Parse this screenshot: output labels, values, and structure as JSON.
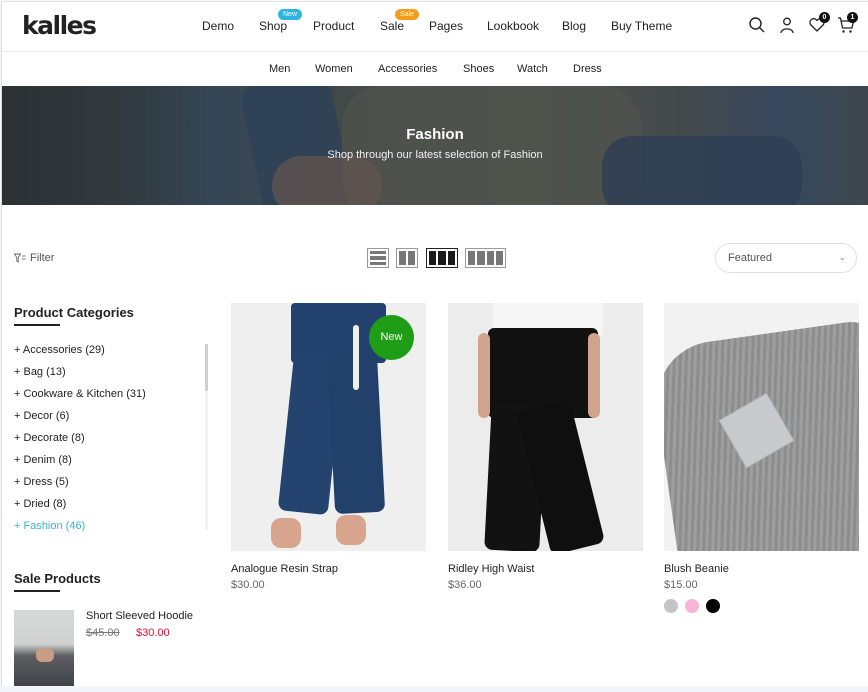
{
  "header": {
    "logo": "kalles",
    "nav": [
      {
        "label": "Demo"
      },
      {
        "label": "Shop",
        "badge": "New"
      },
      {
        "label": "Product"
      },
      {
        "label": "Sale",
        "badge": "Sale"
      },
      {
        "label": "Pages"
      },
      {
        "label": "Lookbook"
      },
      {
        "label": "Blog"
      },
      {
        "label": "Buy Theme"
      }
    ],
    "icons": {
      "search": "search-icon",
      "account": "user-icon",
      "wishlist": "heart-icon",
      "cart": "cart-icon"
    },
    "wishlist_count": "0",
    "cart_count": "1"
  },
  "subnav": [
    "Men",
    "Women",
    "Accessories",
    "Shoes",
    "Watch",
    "Dress"
  ],
  "hero": {
    "title": "Fashion",
    "subtitle": "Shop through our latest selection of Fashion"
  },
  "toolbar": {
    "filter_label": "Filter",
    "layouts": [
      "list",
      "2-columns",
      "3-columns",
      "4-columns"
    ],
    "active_layout": "3-columns",
    "sort_value": "Featured"
  },
  "sidebar": {
    "categories_title": "Product Categories",
    "categories": [
      {
        "label": "+ Accessories (29)"
      },
      {
        "label": "+ Bag (13)"
      },
      {
        "label": "+ Cookware & Kitchen (31)"
      },
      {
        "label": "+ Decor (6)"
      },
      {
        "label": "+ Decorate (8)"
      },
      {
        "label": "+ Denim (8)"
      },
      {
        "label": "+ Dress (5)"
      },
      {
        "label": "+ Dried (8)"
      },
      {
        "label": "+ Fashion (46)",
        "active": true
      }
    ],
    "sale_title": "Sale Products",
    "sale_products": [
      {
        "name": "Short Sleeved Hoodie",
        "old_price": "$45.00",
        "price": "$30.00"
      }
    ]
  },
  "products": [
    {
      "name": "Analogue Resin Strap",
      "price": "$30.00",
      "badge": "New"
    },
    {
      "name": "Ridley High Waist",
      "price": "$36.00"
    },
    {
      "name": "Blush Beanie",
      "price": "$15.00",
      "swatches": [
        "#c4c4c4",
        "#f5b6d6",
        "#000000"
      ]
    }
  ],
  "colors": {
    "accent": "#35b3d4",
    "sale_price": "#e0112b",
    "new_badge": "#1f9d16",
    "nav_badge_new": "#2fb3e0",
    "nav_badge_sale": "#f39c1e"
  }
}
